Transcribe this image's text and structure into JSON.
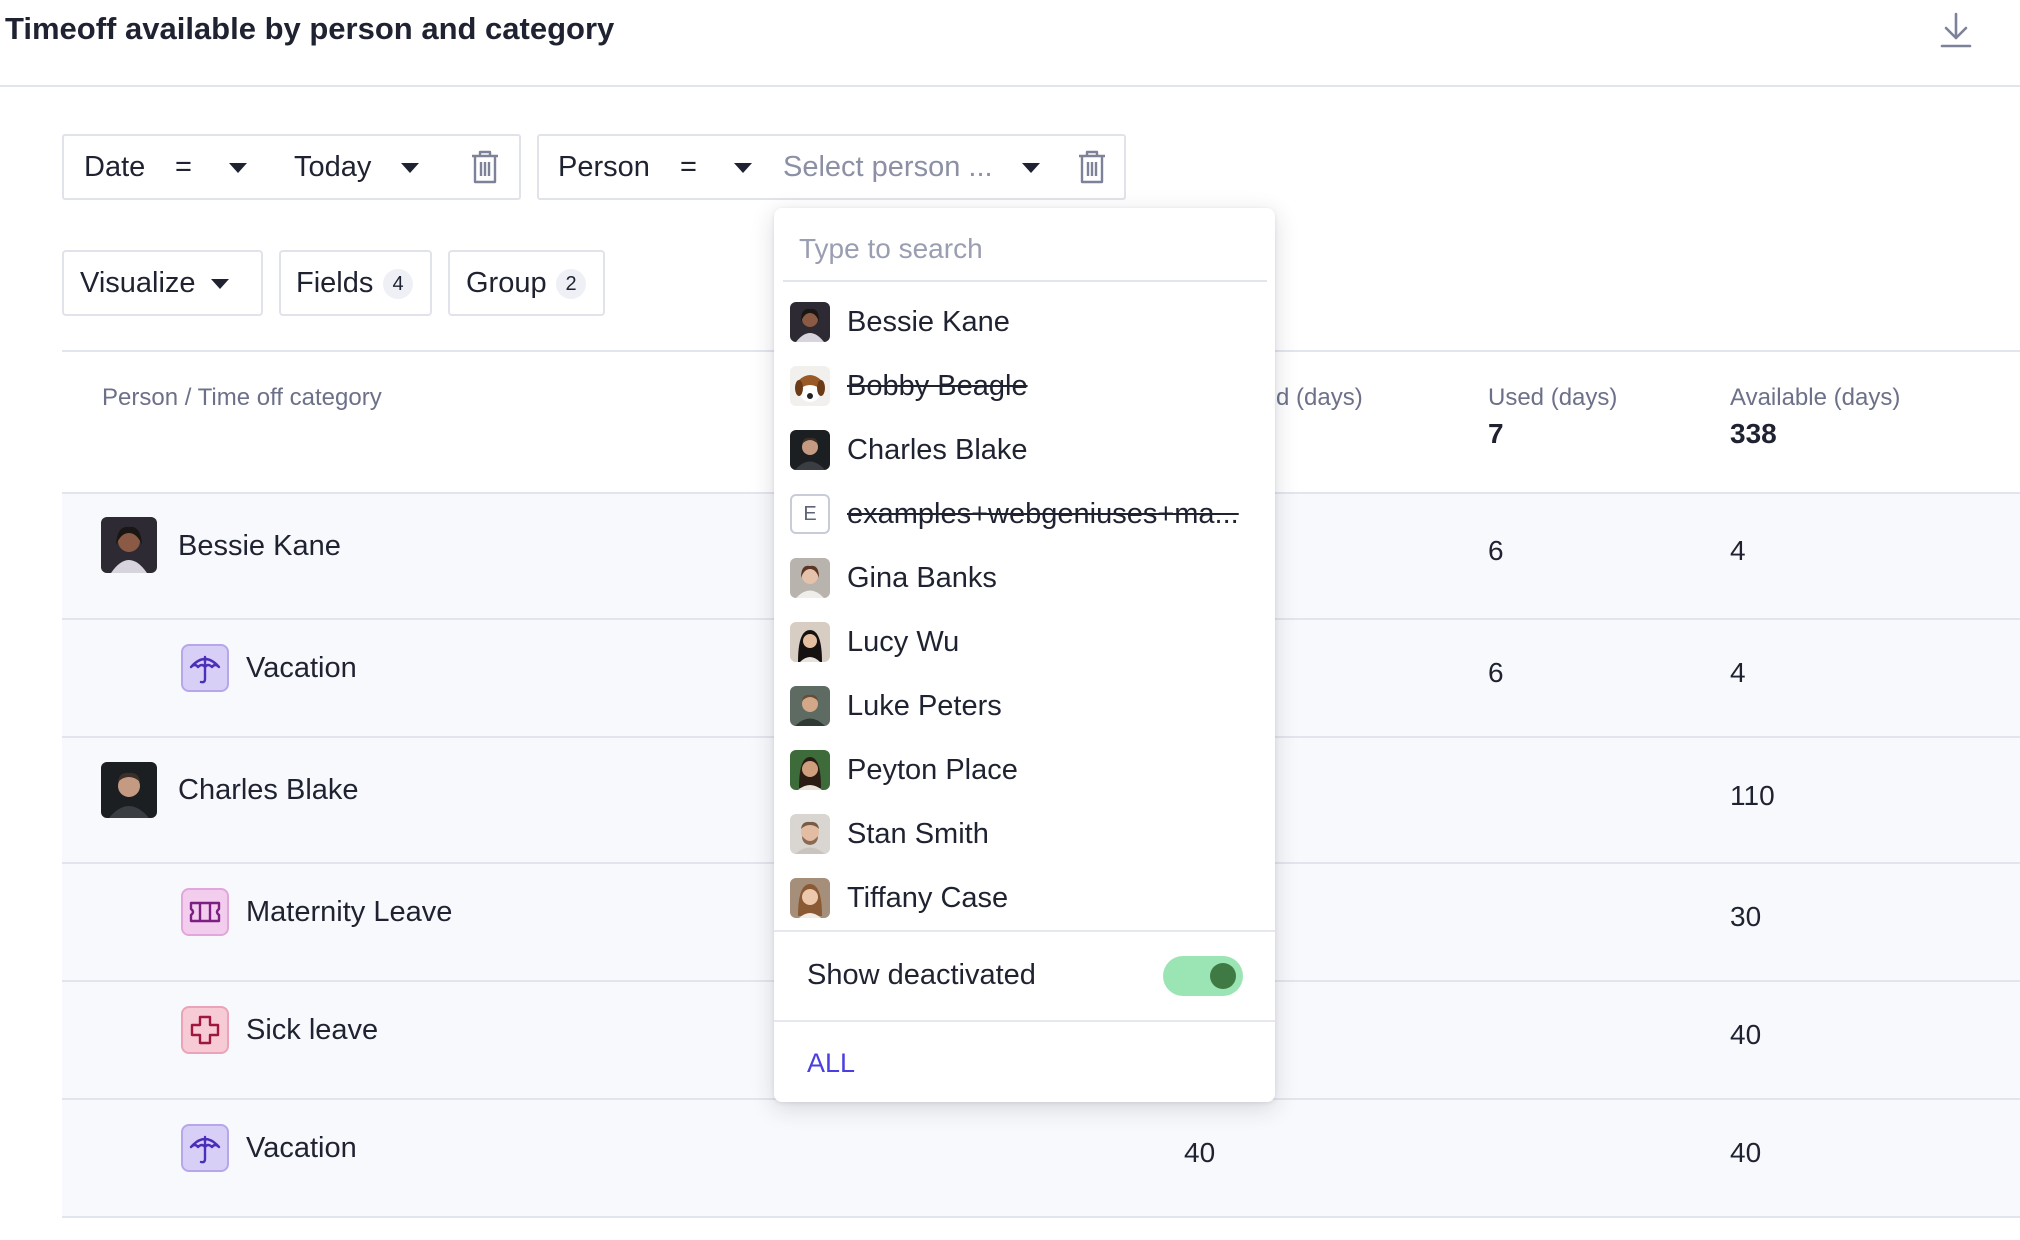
{
  "header": {
    "title": "Timeoff available by person and category",
    "download_icon": "download-icon"
  },
  "filters": [
    {
      "field": "Date",
      "operator": "=",
      "value": "Today",
      "value_is_placeholder": false
    },
    {
      "field": "Person",
      "operator": "=",
      "value": "Select person ...",
      "value_is_placeholder": true
    }
  ],
  "toolbar": {
    "visualize": "Visualize",
    "fields": {
      "label": "Fields",
      "count": "4"
    },
    "group": {
      "label": "Group",
      "count": "2"
    }
  },
  "table": {
    "columns": {
      "person": "Person / Time off category",
      "accrued_partial": "d (days)",
      "used": {
        "label": "Used (days)",
        "total": "7"
      },
      "available": {
        "label": "Available (days)",
        "total": "338"
      }
    },
    "rows": [
      {
        "kind": "person",
        "name": "Bessie Kane",
        "avatar": "bessie-kane-avatar",
        "accrued": "",
        "used": "6",
        "available": "4"
      },
      {
        "kind": "category",
        "name": "Vacation",
        "icon": "umbrella-icon",
        "accrued": "",
        "used": "6",
        "available": "4"
      },
      {
        "kind": "person",
        "name": "Charles Blake",
        "avatar": "charles-blake-avatar",
        "accrued": "",
        "used": "",
        "available": "110"
      },
      {
        "kind": "category",
        "name": "Maternity Leave",
        "icon": "ticket-icon",
        "accrued": "",
        "used": "",
        "available": "30"
      },
      {
        "kind": "category",
        "name": "Sick leave",
        "icon": "medical-cross-icon",
        "accrued": "",
        "used": "",
        "available": "40"
      },
      {
        "kind": "category",
        "name": "Vacation",
        "icon": "umbrella-icon",
        "accrued": "40",
        "used": "",
        "available": "40"
      }
    ]
  },
  "person_dropdown": {
    "search_placeholder": "Type to search",
    "people": [
      {
        "name": "Bessie Kane",
        "deactivated": false,
        "avatar": "bessie"
      },
      {
        "name": "Bobby Beagle",
        "deactivated": true,
        "avatar": "beagle"
      },
      {
        "name": "Charles Blake",
        "deactivated": false,
        "avatar": "charles"
      },
      {
        "name": "examples+webgeniuses+ma...",
        "deactivated": true,
        "avatar": "letter",
        "initial": "E"
      },
      {
        "name": "Gina Banks",
        "deactivated": false,
        "avatar": "gina"
      },
      {
        "name": "Lucy Wu",
        "deactivated": false,
        "avatar": "lucy"
      },
      {
        "name": "Luke Peters",
        "deactivated": false,
        "avatar": "luke"
      },
      {
        "name": "Peyton Place",
        "deactivated": false,
        "avatar": "peyton"
      },
      {
        "name": "Stan Smith",
        "deactivated": false,
        "avatar": "stan"
      },
      {
        "name": "Tiffany Case",
        "deactivated": false,
        "avatar": "tiffany"
      }
    ],
    "show_deactivated": {
      "label": "Show deactivated",
      "on": true
    },
    "all_label": "ALL"
  },
  "colors": {
    "accent": "#4b3fe0",
    "toggle_track": "#9be4b4",
    "toggle_knob": "#3f7a44",
    "vacation_bg": "#d8cff6",
    "maternity_bg": "#f3cdee",
    "sick_bg": "#f7cbd6"
  }
}
